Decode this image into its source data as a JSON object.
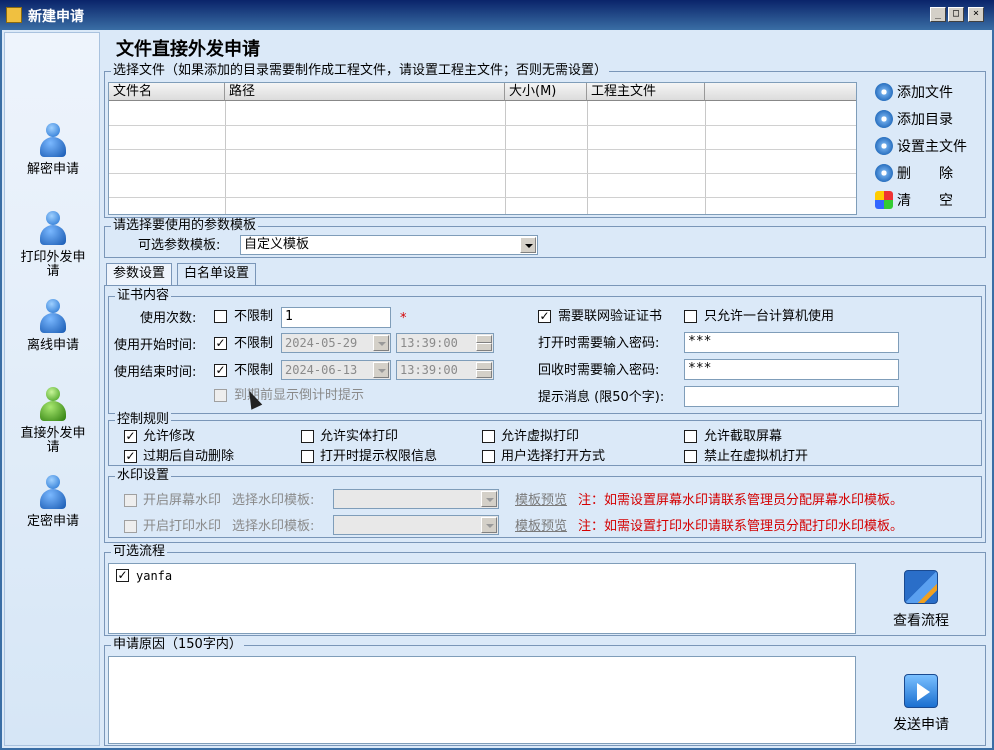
{
  "window": {
    "title": "新建申请",
    "min": "_",
    "max": "□",
    "close": "×"
  },
  "nav": [
    {
      "label": "解密申请",
      "color": "blue"
    },
    {
      "label": "打印外发申请",
      "color": "blue"
    },
    {
      "label": "离线申请",
      "color": "blue"
    },
    {
      "label": "直接外发申请",
      "color": "green"
    },
    {
      "label": "定密申请",
      "color": "blue"
    }
  ],
  "page_title": "文件直接外发申请",
  "files": {
    "legend": "选择文件（如果添加的目录需要制作成工程文件，请设置工程主文件；否则无需设置）",
    "columns": [
      "文件名",
      "路径",
      "大小(M)",
      "工程主文件"
    ],
    "buttons": [
      "添加文件",
      "添加目录",
      "设置主文件",
      "删　　除",
      "清　　空"
    ]
  },
  "template": {
    "legend": "请选择要使用的参数模板",
    "label": "可选参数模板:",
    "value": "自定义模板"
  },
  "tabs": [
    "参数设置",
    "白名单设置"
  ],
  "cert": {
    "legend": "证书内容",
    "use_count_label": "使用次数:",
    "unlimited": "不限制",
    "use_count_value": "1",
    "required_mark": "*",
    "start_label": "使用开始时间:",
    "start_date": "2024-05-29",
    "start_time": "13:39:00",
    "end_label": "使用结束时间:",
    "end_date": "2024-06-13",
    "end_time": "13:39:00",
    "countdown_label": "到期前显示倒计时提示",
    "net_verify": "需要联网验证证书",
    "one_pc": "只允许一台计算机使用",
    "open_pwd_label": "打开时需要输入密码:",
    "open_pwd_value": "***",
    "recycle_pwd_label": "回收时需要输入密码:",
    "recycle_pwd_value": "***",
    "hint_label": "提示消息 (限50个字):",
    "hint_value": ""
  },
  "control": {
    "legend": "控制规则",
    "items": [
      {
        "label": "允许修改",
        "checked": true
      },
      {
        "label": "允许实体打印",
        "checked": false
      },
      {
        "label": "允许虚拟打印",
        "checked": false
      },
      {
        "label": "允许截取屏幕",
        "checked": false
      },
      {
        "label": "过期后自动删除",
        "checked": true
      },
      {
        "label": "打开时提示权限信息",
        "checked": false
      },
      {
        "label": "用户选择打开方式",
        "checked": false
      },
      {
        "label": "禁止在虚拟机打开",
        "checked": false
      }
    ]
  },
  "watermark": {
    "legend": "水印设置",
    "screen_label": "开启屏幕水印",
    "print_label": "开启打印水印",
    "select_label": "选择水印模板:",
    "preview": "模板预览",
    "screen_note": "注：如需设置屏幕水印请联系管理员分配屏幕水印模板。",
    "print_note": "注：如需设置打印水印请联系管理员分配打印水印模板。"
  },
  "flow": {
    "legend": "可选流程",
    "items": [
      {
        "label": "yanfa",
        "checked": true
      }
    ],
    "view_button": "查看流程"
  },
  "reason": {
    "legend": "申请原因（150字内）",
    "value": "",
    "send_button": "发送申请"
  },
  "check_mark": "✓"
}
